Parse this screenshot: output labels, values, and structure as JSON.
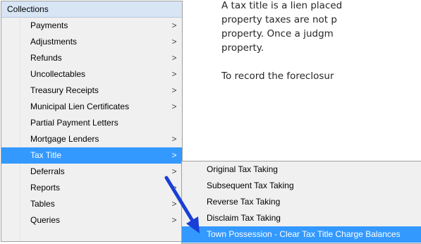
{
  "document": {
    "lines": [
      "A tax title is a lien placed",
      "property taxes are not p",
      "property. Once a judgm",
      "property."
    ],
    "paragraph2": "To record the foreclosur"
  },
  "menu": {
    "header": "Collections",
    "items": [
      {
        "label": "Payments",
        "submenu": true
      },
      {
        "label": "Adjustments",
        "submenu": true
      },
      {
        "label": "Refunds",
        "submenu": true
      },
      {
        "label": "Uncollectables",
        "submenu": true
      },
      {
        "label": "Treasury Receipts",
        "submenu": true
      },
      {
        "label": "Municipal Lien Certificates",
        "submenu": true
      },
      {
        "label": "Partial Payment Letters",
        "submenu": false
      },
      {
        "label": "Mortgage Lenders",
        "submenu": true
      },
      {
        "label": "Tax Title",
        "submenu": true,
        "active": true
      },
      {
        "label": "Deferrals",
        "submenu": true
      },
      {
        "label": "Reports",
        "submenu": true
      },
      {
        "label": "Tables",
        "submenu": true
      },
      {
        "label": "Queries",
        "submenu": true
      }
    ],
    "chevron": ">"
  },
  "submenu": {
    "items": [
      {
        "label": "Original Tax Taking"
      },
      {
        "label": "Subsequent Tax Taking"
      },
      {
        "label": "Reverse Tax Taking"
      },
      {
        "label": "Disclaim Tax Taking"
      },
      {
        "label": "Town Possession - Clear Tax Title Charge Balances",
        "active": true
      }
    ]
  },
  "colors": {
    "highlight": "#3399ff",
    "menu_bg": "#f0f0f0",
    "header_bg": "#d7e5f5",
    "arrow": "#1a3fd6"
  },
  "icons": {
    "chevron": "chevron-right-icon",
    "arrow": "pointer-arrow-icon"
  }
}
